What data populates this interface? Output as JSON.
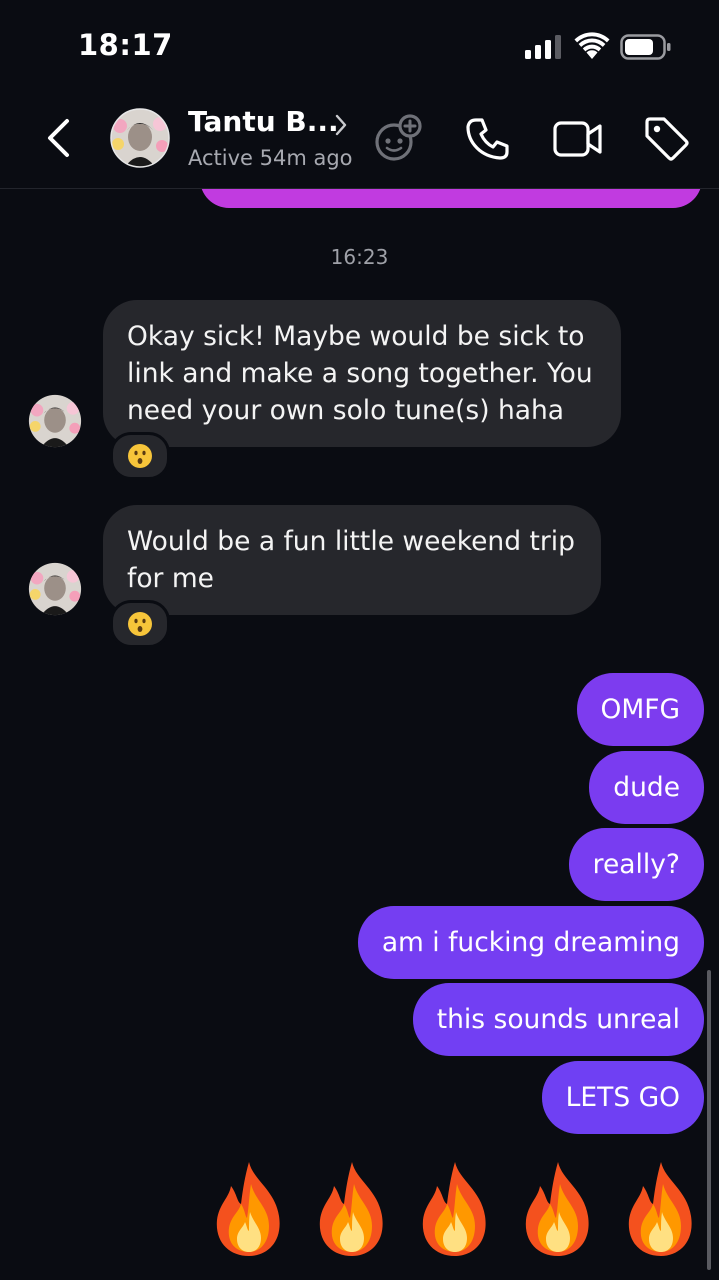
{
  "status_bar": {
    "time": "18:17"
  },
  "header": {
    "contact_name": "Tantu B...",
    "active_status": "Active 54m ago"
  },
  "thread": {
    "timestamp": "16:23",
    "incoming": [
      {
        "text": "Okay sick! Maybe would be sick to link and make a song together. You need your own solo tune(s) haha",
        "reaction": "hushed-face"
      },
      {
        "text": "Would be a fun little weekend trip for me",
        "reaction": "hushed-face"
      }
    ],
    "outgoing": [
      "OMFG",
      "dude",
      "really?",
      "am i fucking dreaming",
      "this sounds unreal",
      "LETS GO"
    ],
    "fire_emojis": 5
  },
  "colors": {
    "background": "#0a0c12",
    "incoming_bubble": "#26272c",
    "outgoing_bubble": "#7a3df0",
    "previous_bubble": "#c13be0",
    "secondary_text": "#a7a9b0"
  },
  "icons": {
    "back": "chevron-left-icon",
    "game": "game-controller-icon",
    "call": "phone-icon",
    "video": "video-camera-icon",
    "tag": "tag-icon",
    "reaction": "hushed-face-icon",
    "fire": "fire-icon"
  }
}
